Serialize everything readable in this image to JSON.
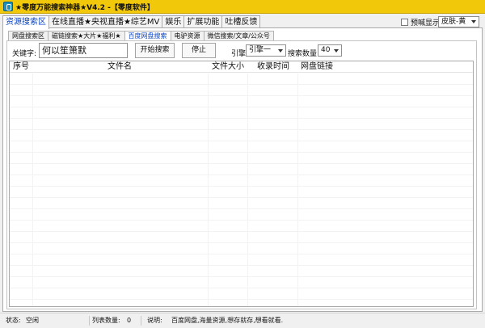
{
  "window": {
    "title": "★零度万能搜索神器★V4.2 -【零度软件】"
  },
  "top_tabs": [
    "资源搜索区",
    "在线直播★央视直播★综艺MV",
    "娱乐",
    "扩展功能",
    "吐槽反馈"
  ],
  "top_options": {
    "prevent_label": "预喊显示",
    "skin_value": "皮肤-黄"
  },
  "sub_tabs": [
    "网盘搜索区",
    "磁链搜索★大片★福利★",
    "百度网盘搜索",
    "电驴资源",
    "微信搜索/文章/公众号"
  ],
  "search": {
    "keyword_label": "关键字:",
    "keyword_value": "何以笙箫默",
    "start_label": "开始搜索",
    "stop_label": "停止",
    "engine_label": "引擎:",
    "engine_value": "引擎一",
    "count_label": "搜索数量:",
    "count_value": "40"
  },
  "table": {
    "columns": [
      "序号",
      "文件名",
      "文件大小",
      "收录时间",
      "网盘链接"
    ]
  },
  "status": {
    "state_label": "状态:",
    "state_value": "空闲",
    "list_label": "列表数量:",
    "list_value": "0",
    "note_label": "说明:",
    "note_value": "百度网盘,海量资源,想存就存,想看就看."
  },
  "colors": {
    "title_bar": "#f1c80a",
    "active_tab_text": "#0a44c2"
  },
  "icons": [
    "app-icon",
    "checkbox-icon",
    "dropdown-arrow-icon"
  ]
}
